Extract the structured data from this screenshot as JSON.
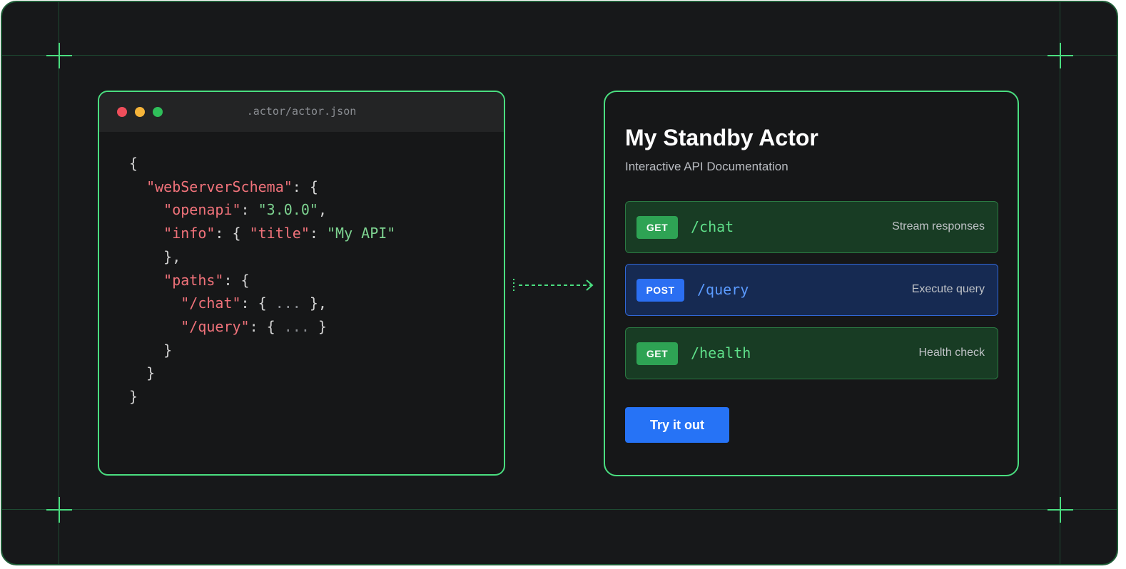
{
  "code_window": {
    "filename": ".actor/actor.json",
    "lines": [
      [
        {
          "t": "{",
          "c": "p"
        }
      ],
      [
        {
          "t": "  ",
          "c": "p"
        },
        {
          "t": "\"webServerSchema\"",
          "c": "k"
        },
        {
          "t": ": {",
          "c": "p"
        }
      ],
      [
        {
          "t": "    ",
          "c": "p"
        },
        {
          "t": "\"openapi\"",
          "c": "k"
        },
        {
          "t": ": ",
          "c": "p"
        },
        {
          "t": "\"3.0.0\"",
          "c": "s"
        },
        {
          "t": ",",
          "c": "p"
        }
      ],
      [
        {
          "t": "    ",
          "c": "p"
        },
        {
          "t": "\"info\"",
          "c": "k"
        },
        {
          "t": ": { ",
          "c": "p"
        },
        {
          "t": "\"title\"",
          "c": "k"
        },
        {
          "t": ": ",
          "c": "p"
        },
        {
          "t": "\"My API\"",
          "c": "s"
        }
      ],
      [
        {
          "t": "    },",
          "c": "p"
        }
      ],
      [
        {
          "t": "    ",
          "c": "p"
        },
        {
          "t": "\"paths\"",
          "c": "k"
        },
        {
          "t": ": {",
          "c": "p"
        }
      ],
      [
        {
          "t": "      ",
          "c": "p"
        },
        {
          "t": "\"/chat\"",
          "c": "k"
        },
        {
          "t": ": { ",
          "c": "p"
        },
        {
          "t": "...",
          "c": "m"
        },
        {
          "t": " },",
          "c": "p"
        }
      ],
      [
        {
          "t": "      ",
          "c": "p"
        },
        {
          "t": "\"/query\"",
          "c": "k"
        },
        {
          "t": ": { ",
          "c": "p"
        },
        {
          "t": "...",
          "c": "m"
        },
        {
          "t": " }",
          "c": "p"
        }
      ],
      [
        {
          "t": "    }",
          "c": "p"
        }
      ],
      [
        {
          "t": "  }",
          "c": "p"
        }
      ],
      [
        {
          "t": "}",
          "c": "p"
        }
      ]
    ]
  },
  "api_panel": {
    "title": "My Standby Actor",
    "subtitle": "Interactive API Documentation",
    "endpoints": [
      {
        "method": "GET",
        "path": "/chat",
        "description": "Stream responses"
      },
      {
        "method": "POST",
        "path": "/query",
        "description": "Execute query"
      },
      {
        "method": "GET",
        "path": "/health",
        "description": "Health check"
      }
    ],
    "try_button_label": "Try it out"
  },
  "colors": {
    "accent_green": "#4ade80",
    "background": "#17181a",
    "get_badge": "#2ea354",
    "post_badge": "#2b6ff2",
    "button_blue": "#2673f6"
  }
}
